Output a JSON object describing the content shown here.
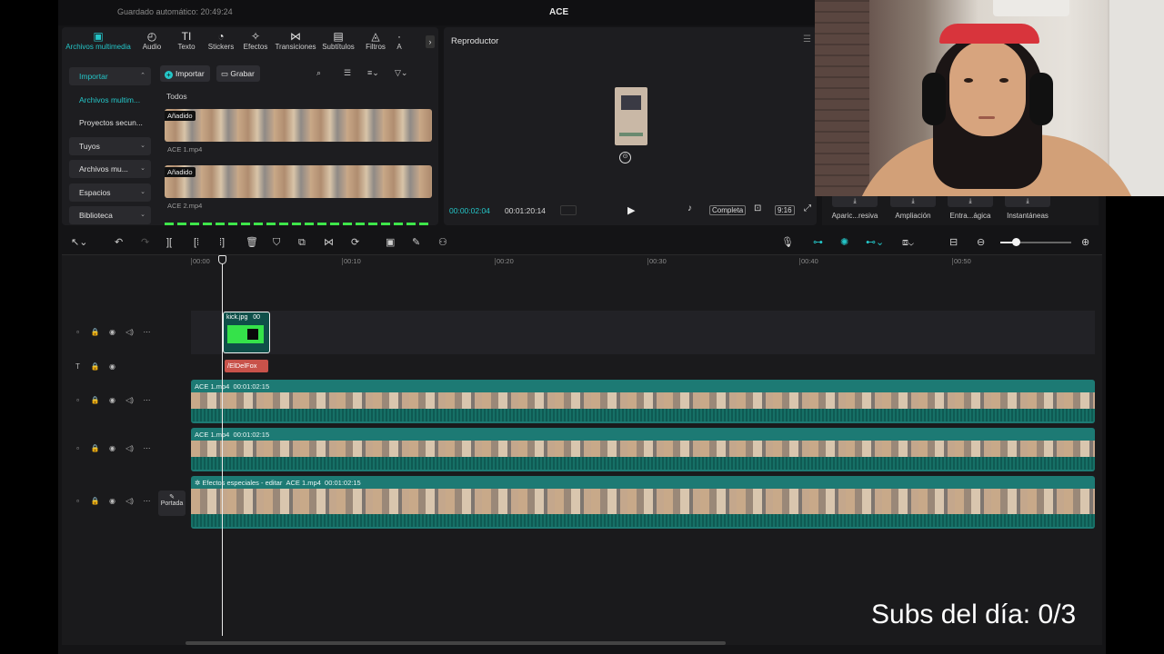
{
  "window": {
    "autosave": "Guardado automático: 20:49:24",
    "title": "ACE"
  },
  "media_tabs": [
    {
      "label": "Archivos multimedia",
      "icon": "media-icon"
    },
    {
      "label": "Audio",
      "icon": "audio-icon"
    },
    {
      "label": "Texto",
      "icon": "text-icon"
    },
    {
      "label": "Stickers",
      "icon": "sticker-icon"
    },
    {
      "label": "Efectos",
      "icon": "effects-icon"
    },
    {
      "label": "Transiciones",
      "icon": "transition-icon"
    },
    {
      "label": "Subtítulos",
      "icon": "subtitles-icon"
    },
    {
      "label": "Filtros",
      "icon": "filters-icon"
    },
    {
      "label": "A",
      "icon": "more-icon"
    }
  ],
  "media_sidebar": [
    {
      "label": "Importar"
    },
    {
      "label": "Archivos multim..."
    },
    {
      "label": "Proyectos secun..."
    },
    {
      "label": "Tuyos"
    },
    {
      "label": "Archivos mu..."
    },
    {
      "label": "Espacios"
    },
    {
      "label": "Biblioteca"
    }
  ],
  "media_toolbar": {
    "import_label": "Importar",
    "record_label": "Grabar"
  },
  "media": {
    "filter_label": "Todos",
    "clips": [
      {
        "tag": "Añadido",
        "name": "ACE 1.mp4"
      },
      {
        "tag": "Añadido",
        "name": "ACE 2.mp4"
      }
    ]
  },
  "player": {
    "title": "Reproductor",
    "current_time": "00:00:02:04",
    "total_time": "00:01:20:14",
    "quality_label": "Completa",
    "ratio_label": "9:16"
  },
  "effects_strip": [
    {
      "label": "Aparic...resiva"
    },
    {
      "label": "Ampliación"
    },
    {
      "label": "Entra...ágica"
    },
    {
      "label": "Instantáneas"
    }
  ],
  "ruler": [
    "00:00",
    "00:10",
    "00:20",
    "00:30",
    "00:40",
    "00:50"
  ],
  "tracks": {
    "sticker_clip_name": "kick.jpg",
    "sticker_clip_time": "00",
    "text_clip": "/ElDelFox",
    "video1": {
      "name": "ACE 1.mp4",
      "duration": "00:01:02:15"
    },
    "video2": {
      "name": "ACE 1.mp4",
      "duration": "00:01:02:15"
    },
    "video3": {
      "effect": "Efectos especiales - editar",
      "name": "ACE 1.mp4",
      "duration": "00:01:02:15"
    },
    "cover_label": "Portada"
  },
  "overlay_text": "Subs del día: 0/3",
  "colors": {
    "accent": "#24c6c8",
    "track": "#1d7a74",
    "text_clip": "#c8524a",
    "sticker_green": "#35e24a"
  }
}
